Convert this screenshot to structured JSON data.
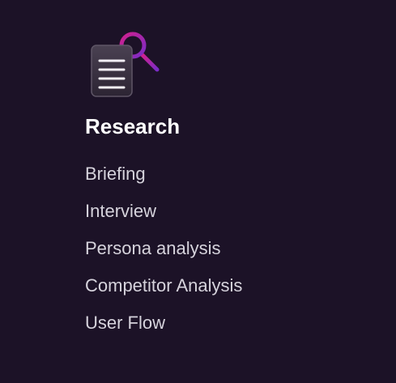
{
  "section": {
    "icon": "document-search-icon",
    "title": "Research",
    "items": [
      {
        "label": "Briefing"
      },
      {
        "label": "Interview"
      },
      {
        "label": "Persona analysis"
      },
      {
        "label": "Competitor Analysis"
      },
      {
        "label": "User Flow"
      }
    ]
  },
  "colors": {
    "background": "#1c1227",
    "title": "#ffffff",
    "item_text": "#d6d3dc",
    "icon_accent_start": "#c41d8f",
    "icon_accent_end": "#7b2cc4"
  }
}
